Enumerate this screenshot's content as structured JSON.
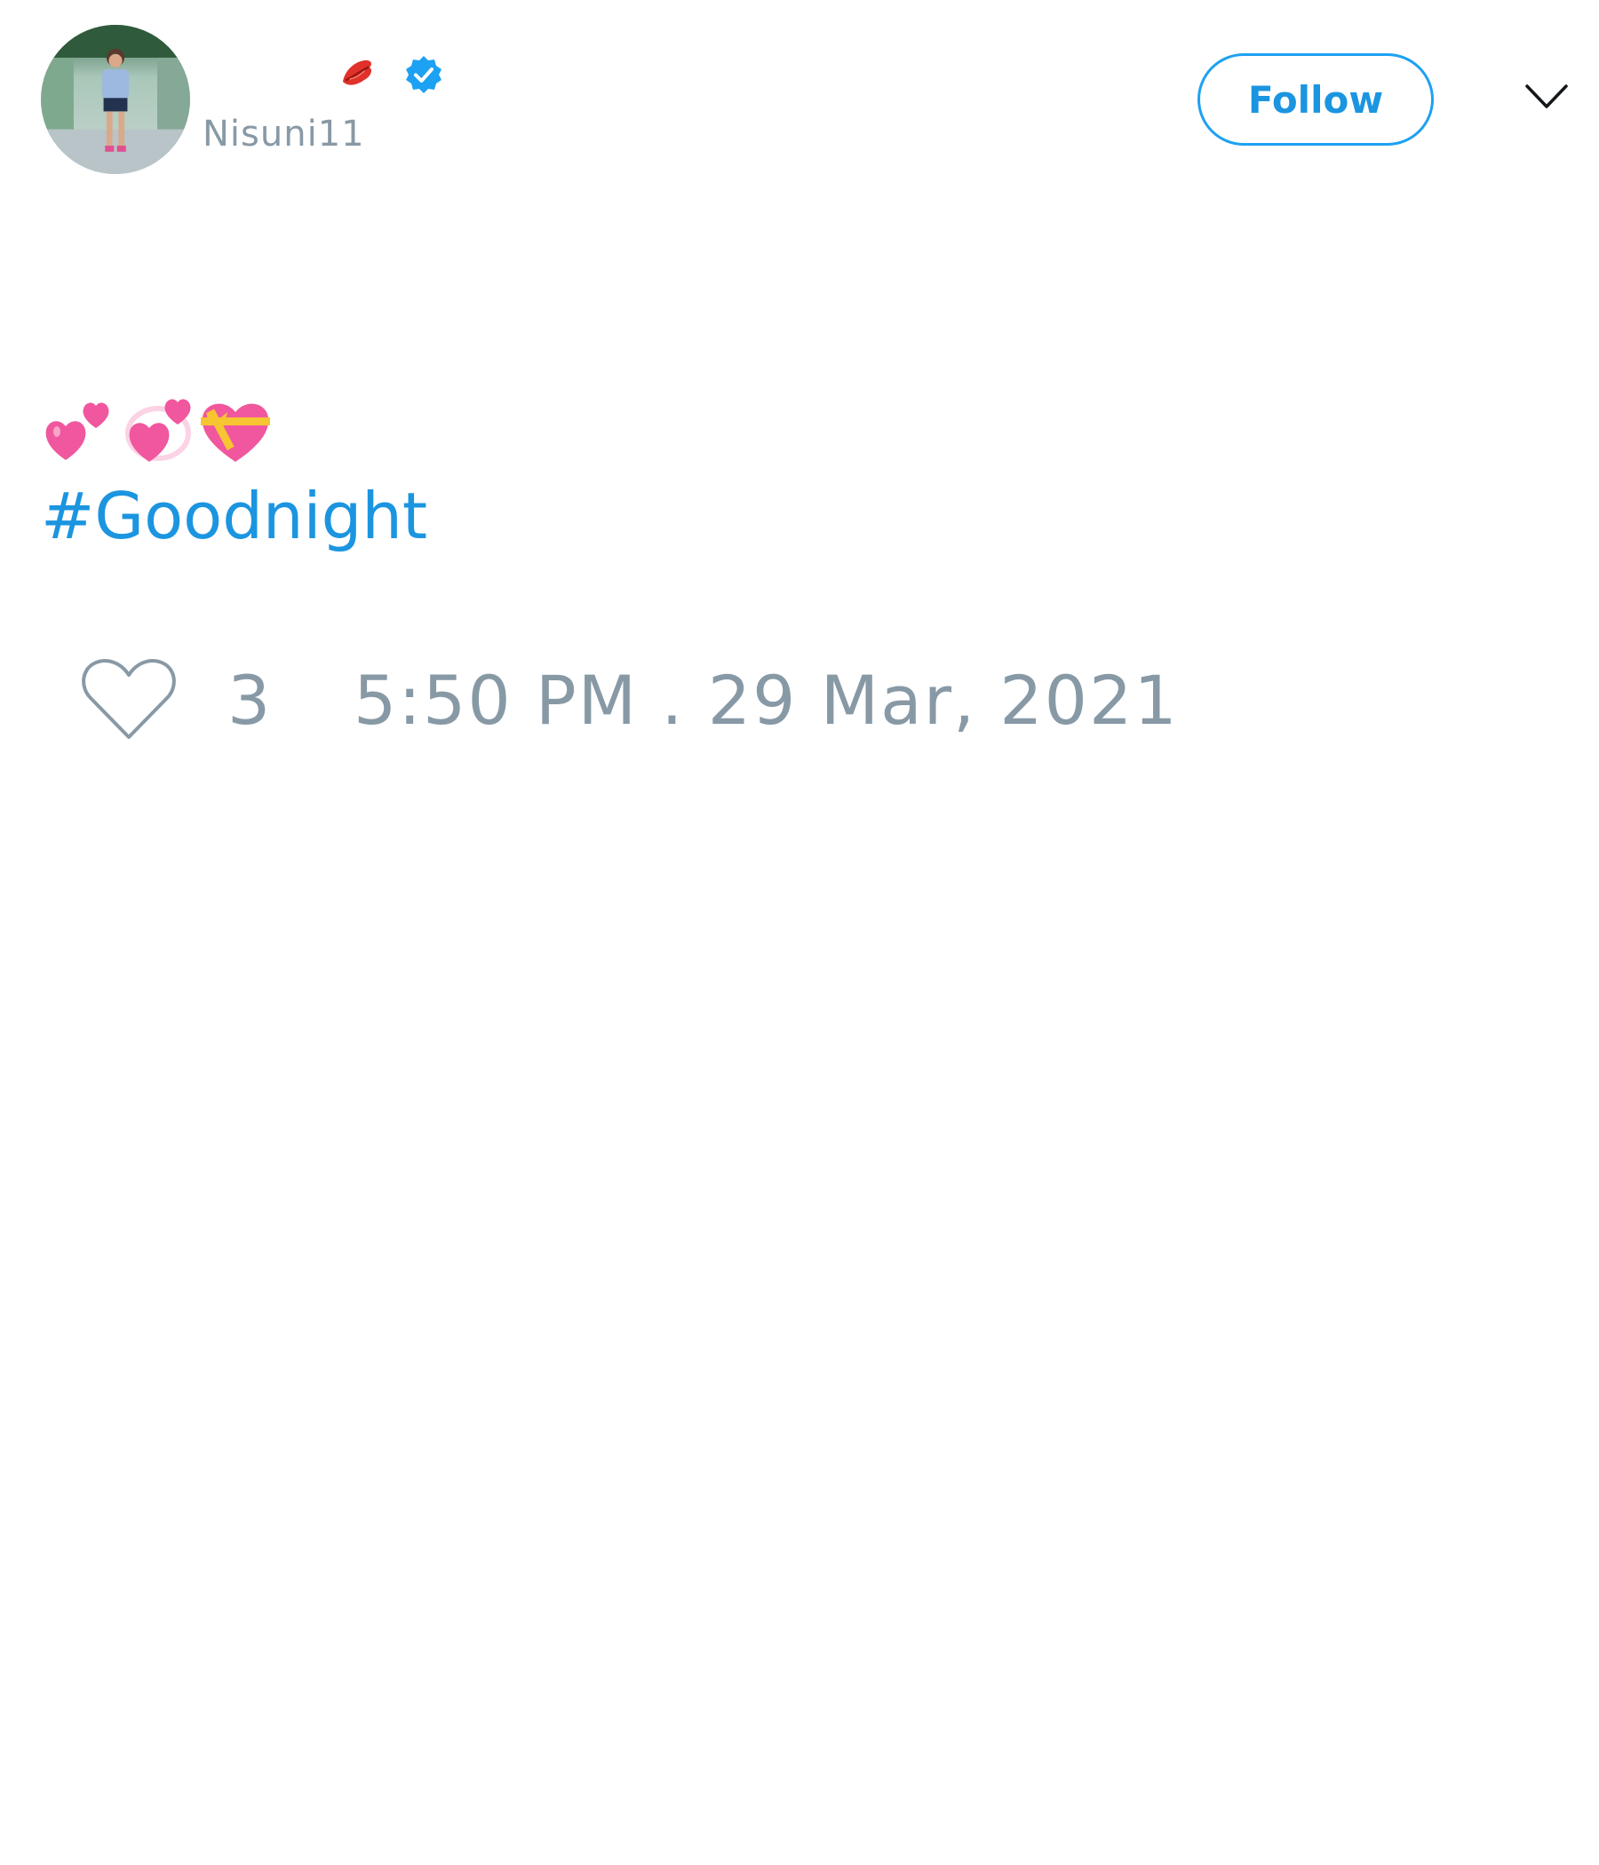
{
  "user": {
    "display_name": "",
    "handle": "Nisuni11",
    "name_emoji": "lips-icon",
    "verified": true,
    "verified_icon": "verified-badge-icon"
  },
  "header": {
    "follow_label": "Follow",
    "menu_icon": "chevron-down-icon"
  },
  "tweet": {
    "emojis": [
      "two-hearts-icon",
      "revolving-hearts-icon",
      "heart-with-ribbon-icon"
    ],
    "hashtag": "#Goodnight"
  },
  "footer": {
    "like_icon": "heart-outline-icon",
    "like_count": "3",
    "timestamp": "5:50 PM . 29 Mar, 2021"
  },
  "colors": {
    "accent": "#1da1f2",
    "link": "#1b95e0",
    "muted": "#8899a6",
    "verified": "#1da1f2",
    "lips": "#e0312b",
    "heart_pink": "#f0579e",
    "ribbon_yellow": "#f7c531"
  }
}
